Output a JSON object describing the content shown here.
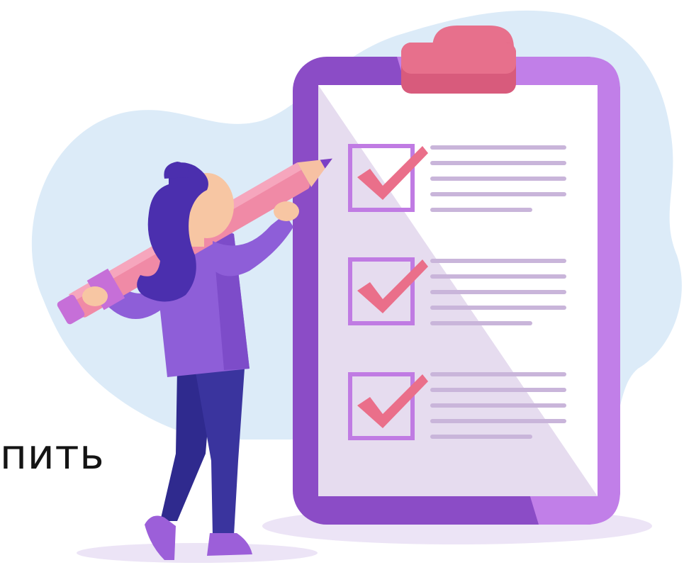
{
  "caption": {
    "partial_word": "пить"
  },
  "illustration": {
    "subject": "woman-with-pencil-and-checklist-clipboard",
    "checklist": {
      "rows": 3,
      "checked": 3,
      "lines_per_row": 5
    },
    "colors": {
      "blob_background": "#dcebf8",
      "clipboard_frame": "#8b4cc6",
      "clipboard_frame_light": "#c17fe8",
      "paper": "#ffffff",
      "paper_shade": "#e6dcef",
      "clip": "#e7708c",
      "checkbox": "#c07be3",
      "checkmark": "#ea6f8a",
      "text_lines": "#c9b5da",
      "pencil": "#f08aa6",
      "pencil_band": "#c66fd8",
      "shirt": "#8e5ed8",
      "hair": "#4b2fae",
      "pants": "#2f2a8e",
      "skin": "#f7c6a3",
      "shoes": "#9c5fd9",
      "shadow": "#ece4f6"
    }
  }
}
